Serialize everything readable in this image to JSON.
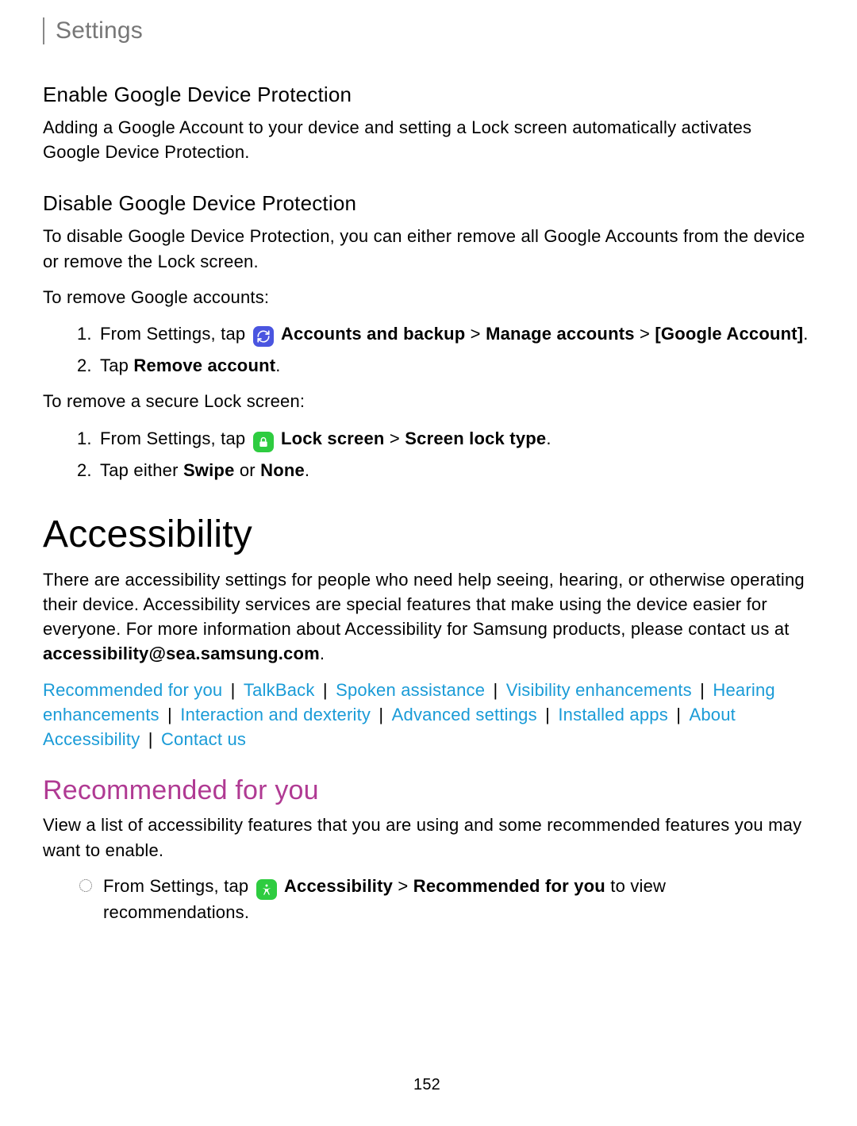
{
  "header": {
    "title": "Settings"
  },
  "sections": {
    "enable_gdp": {
      "heading": "Enable Google Device Protection",
      "body": "Adding a Google Account to your device and setting a Lock screen automatically activates Google Device Protection."
    },
    "disable_gdp": {
      "heading": "Disable Google Device Protection",
      "body": "To disable Google Device Protection, you can either remove all Google Accounts from the device or remove the Lock screen.",
      "remove_accounts_intro": "To remove Google accounts:",
      "step1_prefix": "From Settings, tap ",
      "step1_bold_a": "Accounts and backup",
      "step1_sep1": " > ",
      "step1_bold_b": "Manage accounts",
      "step1_sep2": " > ",
      "step1_bold_c": "[Google Account]",
      "step1_suffix": ".",
      "step2_prefix": "Tap ",
      "step2_bold": "Remove account",
      "step2_suffix": ".",
      "remove_lock_intro": "To remove a secure Lock screen:",
      "lock_step1_prefix": "From Settings, tap ",
      "lock_step1_bold_a": "Lock screen",
      "lock_step1_sep": " > ",
      "lock_step1_bold_b": "Screen lock type",
      "lock_step1_suffix": ".",
      "lock_step2_prefix": "Tap either ",
      "lock_step2_bold_a": "Swipe",
      "lock_step2_mid": " or ",
      "lock_step2_bold_b": "None",
      "lock_step2_suffix": "."
    }
  },
  "accessibility": {
    "heading": "Accessibility",
    "body_pre": "There are accessibility settings for people who need help seeing, hearing, or otherwise operating their device. Accessibility services are special features that make using the device easier for everyone. For more information about Accessibility for Samsung products, please contact us at ",
    "email": "accessibility@sea.samsung.com",
    "body_post": ".",
    "links": [
      "Recommended for you",
      "TalkBack",
      "Spoken assistance",
      "Visibility enhancements",
      "Hearing enhancements",
      "Interaction and dexterity",
      "Advanced settings",
      "Installed apps",
      "About Accessibility",
      "Contact us"
    ],
    "pipe": " | "
  },
  "recommended": {
    "heading": "Recommended for you",
    "body": "View a list of accessibility features that you are using and some recommended features you may want to enable.",
    "step_prefix": "From Settings, tap ",
    "step_bold_a": "Accessibility",
    "step_sep": " > ",
    "step_bold_b": "Recommended for you",
    "step_suffix": " to view recommendations."
  },
  "page_number": "152"
}
